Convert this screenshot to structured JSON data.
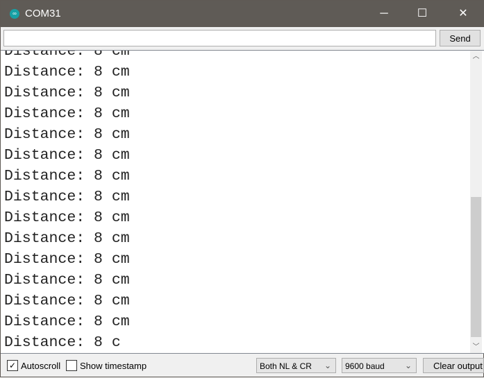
{
  "window": {
    "title": "COM31",
    "logo_icon": "arduino-logo",
    "minimize": "─",
    "maximize": "☐",
    "close": "✕"
  },
  "input": {
    "value": "",
    "send_label": "Send"
  },
  "output": {
    "lines": [
      "Distance: 8 cm",
      "Distance: 8 cm",
      "Distance: 8 cm",
      "Distance: 8 cm",
      "Distance: 8 cm",
      "Distance: 8 cm",
      "Distance: 8 cm",
      "Distance: 8 cm",
      "Distance: 8 cm",
      "Distance: 8 cm",
      "Distance: 8 cm",
      "Distance: 8 cm",
      "Distance: 8 cm",
      "Distance: 8 cm",
      "Distance: 8 c"
    ]
  },
  "bottom": {
    "autoscroll_label": "Autoscroll",
    "autoscroll_checked": true,
    "timestamp_label": "Show timestamp",
    "timestamp_checked": false,
    "line_ending": "Both NL & CR",
    "baud": "9600 baud",
    "clear_label": "Clear output"
  }
}
